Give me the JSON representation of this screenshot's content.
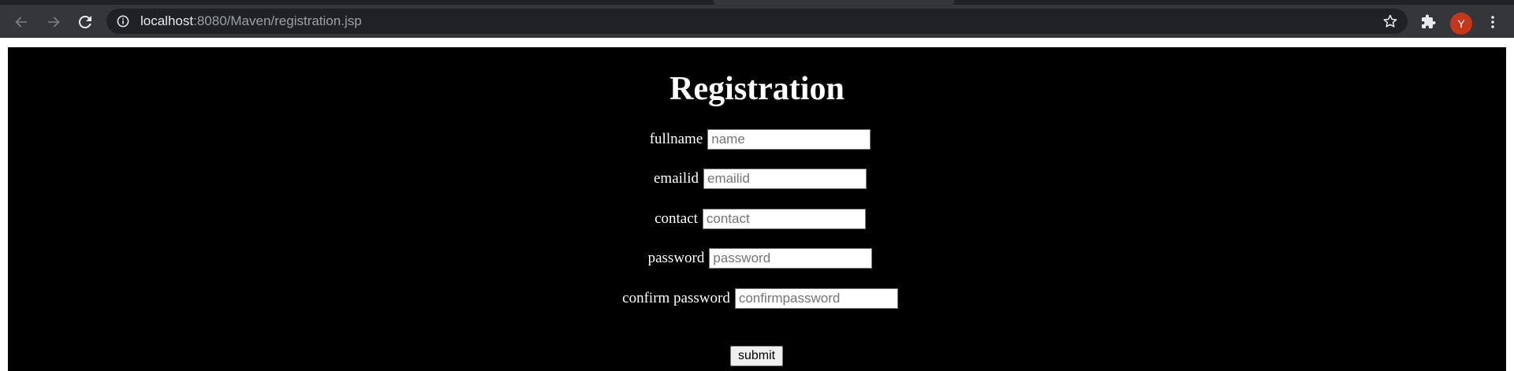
{
  "browser": {
    "url_host": "localhost",
    "url_rest": ":8080/Maven/registration.jsp",
    "avatar_letter": "Y",
    "avatar_color": "#c5361b",
    "icons": {
      "back": "back-arrow-icon",
      "forward": "forward-arrow-icon",
      "reload": "reload-icon",
      "site_info": "info-icon",
      "bookmark": "star-icon",
      "extensions": "puzzle-icon",
      "menu": "kebab-menu-icon"
    }
  },
  "page": {
    "title": "Registration",
    "fields": {
      "fullname": {
        "label": "fullname",
        "placeholder": "name",
        "value": ""
      },
      "emailid": {
        "label": "emailid",
        "placeholder": "emailid",
        "value": ""
      },
      "contact": {
        "label": "contact",
        "placeholder": "contact",
        "value": ""
      },
      "password": {
        "label": "password",
        "placeholder": "password",
        "value": ""
      },
      "confirm_password": {
        "label": "confirm password",
        "placeholder": "confirmpassword",
        "value": ""
      }
    },
    "submit_label": "submit",
    "background_color": "#000000",
    "text_color": "#ffffff"
  }
}
